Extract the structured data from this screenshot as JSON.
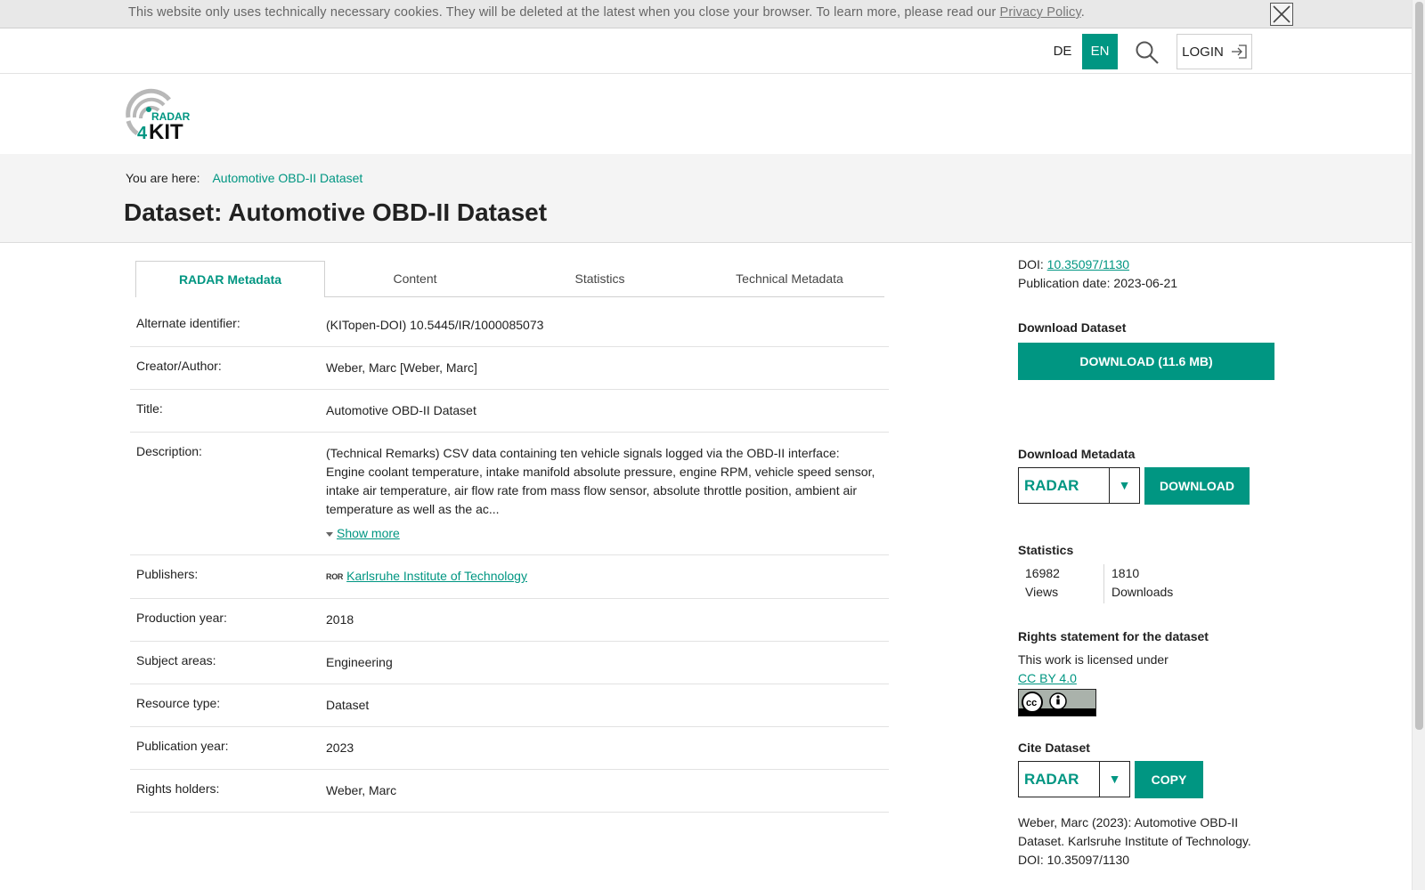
{
  "cookie_bar": {
    "text": "This website only uses technically necessary cookies. They will be deleted at the latest when you close your browser. To learn more, please read our ",
    "link": "Privacy Policy",
    "end": "."
  },
  "nav": {
    "lang_de": "DE",
    "lang_en": "EN",
    "login": "LOGIN"
  },
  "logo": {
    "line1": "RADAR",
    "line2_num": "4",
    "line2_text": "KIT"
  },
  "breadcrumb": {
    "prefix": "You are here:",
    "current": "Automotive OBD-II Dataset"
  },
  "page_title": "Dataset: Automotive OBD-II Dataset",
  "tabs": [
    "RADAR Metadata",
    "Content",
    "Statistics",
    "Technical Metadata"
  ],
  "metadata": {
    "alternate_identifier": {
      "label": "Alternate identifier:",
      "value": "(KITopen-DOI) 10.5445/IR/1000085073"
    },
    "creator": {
      "label": "Creator/Author:",
      "value": "Weber, Marc [Weber, Marc]"
    },
    "title": {
      "label": "Title:",
      "value": "Automotive OBD-II Dataset"
    },
    "description": {
      "label": "Description:",
      "value": "(Technical Remarks) CSV data containing ten vehicle signals logged via the OBD-II interface: Engine coolant temperature, intake manifold absolute pressure, engine RPM, vehicle speed sensor, intake air temperature, air flow rate from mass flow sensor, absolute throttle position, ambient air temperature as well as the ac...",
      "show_more": "Show more"
    },
    "publishers": {
      "label": "Publishers:",
      "ror": "ROR",
      "value": "Karlsruhe Institute of Technology"
    },
    "production_year": {
      "label": "Production year:",
      "value": "2018"
    },
    "subject_areas": {
      "label": "Subject areas:",
      "value": "Engineering"
    },
    "resource_type": {
      "label": "Resource type:",
      "value": "Dataset"
    },
    "publication_year": {
      "label": "Publication year:",
      "value": "2023"
    },
    "rights_holders": {
      "label": "Rights holders:",
      "value": "Weber, Marc"
    }
  },
  "sidebar": {
    "doi_label": "DOI: ",
    "doi": "10.35097/1130",
    "publication_date": "Publication date: 2023-06-21",
    "download_dataset_heading": "Download Dataset",
    "download_dataset_button": "DOWNLOAD (11.6 MB)",
    "download_metadata_heading": "Download Metadata",
    "metadata_format": "RADAR",
    "download_button": "DOWNLOAD",
    "statistics_heading": "Statistics",
    "views_count": "16982",
    "views_label": "Views",
    "downloads_count": "1810",
    "downloads_label": "Downloads",
    "rights_heading": "Rights statement for the dataset",
    "license_text": "This work is licensed under",
    "license_link": "CC BY 4.0",
    "cite_heading": "Cite Dataset",
    "cite_format": "RADAR",
    "copy_button": "COPY",
    "citation": "Weber, Marc (2023): Automotive OBD-II Dataset. Karlsruhe Institute of Technology. DOI: 10.35097/1130"
  },
  "colors": {
    "accent": "#009682",
    "grey_band": "#f4f4f4"
  }
}
